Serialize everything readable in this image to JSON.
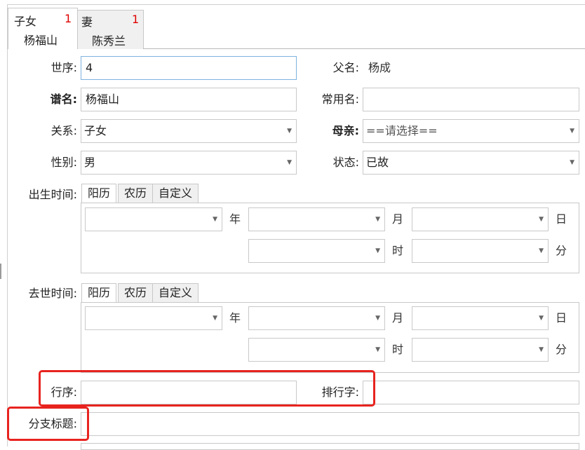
{
  "tabs": [
    {
      "label": "子女",
      "count": "1",
      "name": "杨福山",
      "active": true
    },
    {
      "label": "妻",
      "count": "1",
      "name": "陈秀兰",
      "active": false
    }
  ],
  "form": {
    "generation": {
      "label": "世序:",
      "value": "4"
    },
    "father": {
      "label": "父名:",
      "value": "杨成"
    },
    "genealogy_name": {
      "label": "谱名:",
      "value": "杨福山"
    },
    "common_name": {
      "label": "常用名:",
      "value": ""
    },
    "relation": {
      "label": "关系:",
      "value": "子女"
    },
    "mother": {
      "label": "母亲:",
      "value": "==请选择=="
    },
    "gender": {
      "label": "性别:",
      "value": "男"
    },
    "status": {
      "label": "状态:",
      "value": "已故"
    },
    "birth": {
      "label": "出生时间:",
      "tabs": [
        "阳历",
        "农历",
        "自定义"
      ],
      "units": {
        "year": "年",
        "month": "月",
        "day": "日",
        "hour": "时",
        "minute": "分"
      }
    },
    "death": {
      "label": "去世时间:",
      "tabs": [
        "阳历",
        "农历",
        "自定义"
      ],
      "units": {
        "year": "年",
        "month": "月",
        "day": "日",
        "hour": "时",
        "minute": "分"
      }
    },
    "rank_order": {
      "label": "行序:",
      "value": ""
    },
    "rank_char": {
      "label": "排行字:",
      "value": ""
    },
    "branch_title": {
      "label": "分支标题:",
      "value": ""
    }
  },
  "colors": {
    "highlight": "#e8231f",
    "count": "#e00000",
    "focus_border": "#7fb2dd"
  }
}
